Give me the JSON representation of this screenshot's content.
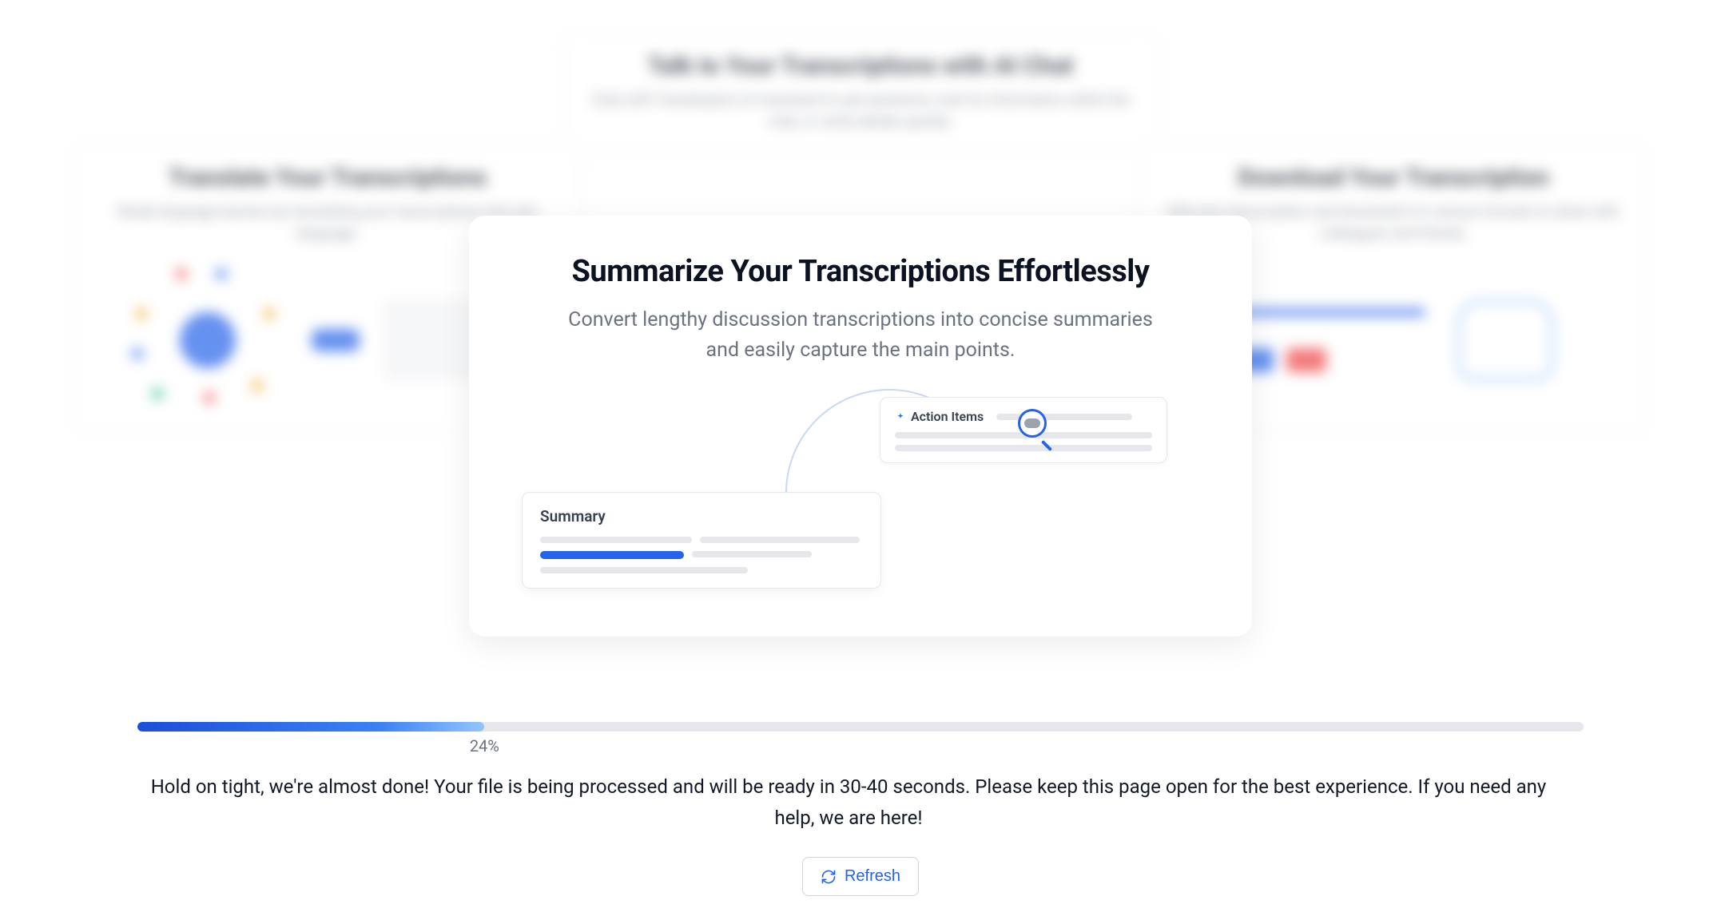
{
  "carousel": {
    "bg_top": {
      "title": "Talk to Your Transcriptions with AI Chat",
      "subtitle": "Chat with Transkriptor's AI assistant to ask questions, look for information within the chat, or verify details quickly."
    },
    "bg_left": {
      "title": "Translate Your Transcriptions",
      "subtitle": "Break language barriers by translating your transcriptions into any language."
    },
    "bg_right": {
      "title": "Download Your Transcription",
      "subtitle": "Edit your transcription and download it in various formats to share with colleagues and friends."
    },
    "main": {
      "title": "Summarize Your Transcriptions Effortlessly",
      "subtitle": "Convert lengthy discussion transcriptions into concise summaries and easily capture the main points.",
      "action_items_label": "Action Items",
      "summary_label": "Summary"
    }
  },
  "progress": {
    "percent": 24,
    "percent_label": "24%",
    "message": "Hold on tight, we're almost done! Your file is being processed and will be ready in 30-40 seconds. Please keep this page open for the best experience. If you need any help, we are here!",
    "refresh_label": "Refresh"
  }
}
